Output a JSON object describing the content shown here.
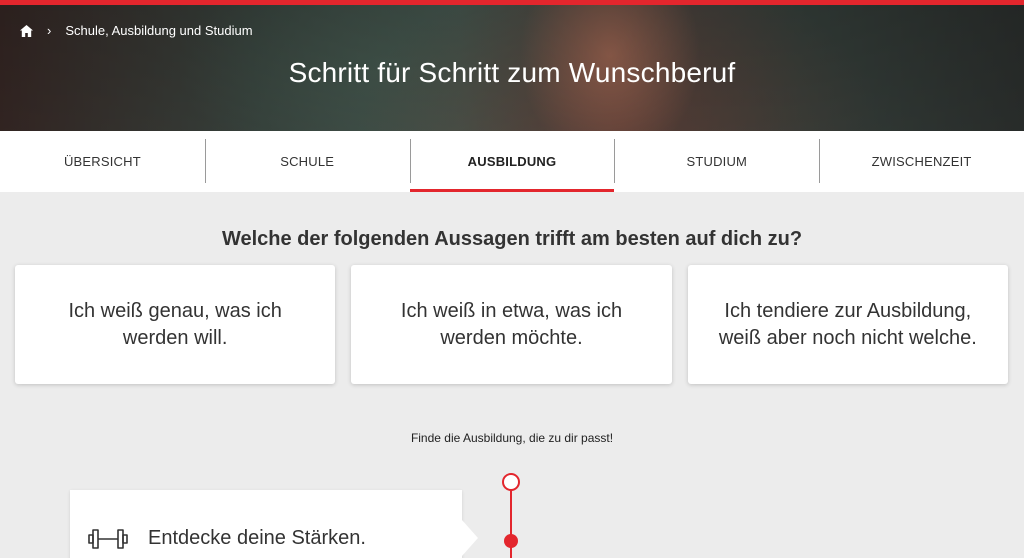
{
  "breadcrumb": {
    "home_icon": "home-icon",
    "separator": "›",
    "current": "Schule, Ausbildung und Studium"
  },
  "hero": {
    "title": "Schritt für Schritt zum Wunschberuf"
  },
  "tabs": [
    {
      "label": "ÜBERSICHT",
      "active": false
    },
    {
      "label": "SCHULE",
      "active": false
    },
    {
      "label": "AUSBILDUNG",
      "active": true
    },
    {
      "label": "STUDIUM",
      "active": false
    },
    {
      "label": "ZWISCHENZEIT",
      "active": false
    }
  ],
  "question": "Welche der folgenden Aussagen trifft am besten auf dich zu?",
  "options": [
    {
      "label": "Ich weiß genau, was ich werden will."
    },
    {
      "label": "Ich weiß in etwa, was ich werden möchte."
    },
    {
      "label": "Ich tendiere zur Ausbildung, weiß aber noch nicht welche."
    }
  ],
  "subline": "Finde die Ausbildung, die zu dir passt!",
  "step": {
    "icon": "dumbbell-icon",
    "title": "Entdecke deine Stärken."
  },
  "colors": {
    "accent": "#e3262d",
    "background": "#ececec",
    "text": "#333333"
  }
}
